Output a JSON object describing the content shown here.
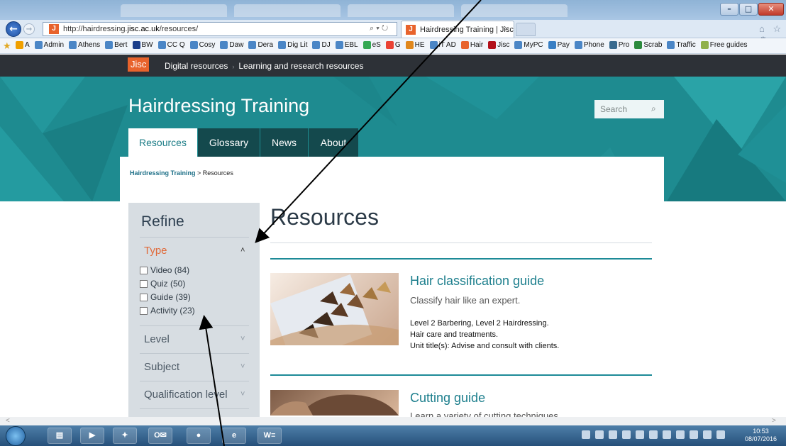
{
  "browser": {
    "url": "http://hairdressing.jisc.ac.uk/resources/",
    "url_prefix": "http://hairdressing.",
    "url_domain": "jisc.ac.uk",
    "url_path": "/resources/",
    "search_glyph": "⌕ ▾ ↻",
    "tab_title": "Hairdressing Training | Jisc",
    "tab_close": "×",
    "favicon_letter": "J",
    "window_buttons": [
      "–",
      "□",
      "✕"
    ],
    "home_star": "⌂ ☆ ⚙"
  },
  "favourites": [
    {
      "label": "A",
      "icon": "amazon-icon",
      "color": "#f0a000"
    },
    {
      "label": "Admin",
      "icon": "ie-icon",
      "color": "#4b86c6"
    },
    {
      "label": "Athens",
      "icon": "ie-icon",
      "color": "#4b86c6"
    },
    {
      "label": "Bert",
      "icon": "ie-icon",
      "color": "#4b86c6"
    },
    {
      "label": "BW",
      "icon": "b-icon",
      "color": "#1a3d8a"
    },
    {
      "label": "CC Q",
      "icon": "ie-icon",
      "color": "#4b86c6"
    },
    {
      "label": "Cosy",
      "icon": "ie-icon",
      "color": "#4b86c6"
    },
    {
      "label": "Daw",
      "icon": "ie-icon",
      "color": "#4b86c6"
    },
    {
      "label": "Dera",
      "icon": "ie-icon",
      "color": "#4b86c6"
    },
    {
      "label": "Dig Lit",
      "icon": "ie-icon",
      "color": "#4b86c6"
    },
    {
      "label": "DJ",
      "icon": "ie-icon",
      "color": "#4b86c6"
    },
    {
      "label": "EBL",
      "icon": "ie-icon",
      "color": "#4b86c6"
    },
    {
      "label": "eS",
      "icon": "chrome-icon",
      "color": "#34a853"
    },
    {
      "label": "G",
      "icon": "google-icon",
      "color": "#ea4335"
    },
    {
      "label": "HE",
      "icon": "fox-icon",
      "color": "#e0871c"
    },
    {
      "label": "iT AD",
      "icon": "ie-icon",
      "color": "#4b86c6"
    },
    {
      "label": "Hair",
      "icon": "jisc-icon",
      "color": "#e8632c"
    },
    {
      "label": "Jisc",
      "icon": "jisc-icon",
      "color": "#b2101a"
    },
    {
      "label": "MyPC",
      "icon": "ie-icon",
      "color": "#4b86c6"
    },
    {
      "label": "Pay",
      "icon": "ring-icon",
      "color": "#3a7fc4"
    },
    {
      "label": "Phone",
      "icon": "ie-icon",
      "color": "#4b86c6"
    },
    {
      "label": "Pro",
      "icon": "monitor-icon",
      "color": "#3a6b8f"
    },
    {
      "label": "Scrab",
      "icon": "tiles-icon",
      "color": "#2b8a3e"
    },
    {
      "label": "Traffic",
      "icon": "ie-icon",
      "color": "#4b86c6"
    },
    {
      "label": "Free guides",
      "icon": "leaf-icon",
      "color": "#8fb04a"
    }
  ],
  "site": {
    "logo": "Jisc",
    "crumb_top": [
      "Digital resources",
      "Learning and research resources"
    ],
    "crumb_sep": "›",
    "title": "Hairdressing Training",
    "search_placeholder": "Search",
    "search_icon": "⌕",
    "nav": [
      "Resources",
      "Glossary",
      "News",
      "About"
    ]
  },
  "breadcrumb": {
    "home": "Hairdressing Training",
    "sep": " > ",
    "current": "Resources"
  },
  "refine": {
    "title": "Refine",
    "type_heading": "Type",
    "type_options": [
      "Video (84)",
      "Quiz (50)",
      "Guide (39)",
      "Activity (23)"
    ],
    "other_filters": [
      "Level",
      "Subject",
      "Qualification level"
    ],
    "chev_up": "˄",
    "chev_down": "˅"
  },
  "main": {
    "heading": "Resources",
    "results": [
      {
        "title": "Hair classification guide",
        "desc": "Classify hair like an expert.",
        "meta": [
          "Level 2 Barbering, Level 2 Hairdressing.",
          "Hair care and treatments.",
          "Unit title(s): Advise and consult with clients."
        ]
      },
      {
        "title": "Cutting guide",
        "desc": "Learn a variety of cutting techniques"
      }
    ]
  },
  "taskbar": {
    "apps": [
      "▤",
      "▶",
      "✦",
      "O✉",
      "●",
      "e",
      "W≡"
    ],
    "time": "10:53",
    "date": "08/07/2016"
  },
  "colors": {
    "teal": "#1e8b90",
    "accent": "#e8632c",
    "link": "#1d7f8d",
    "dark_nav": "#14494d"
  },
  "scroll_arrows": [
    "<",
    ">"
  ]
}
